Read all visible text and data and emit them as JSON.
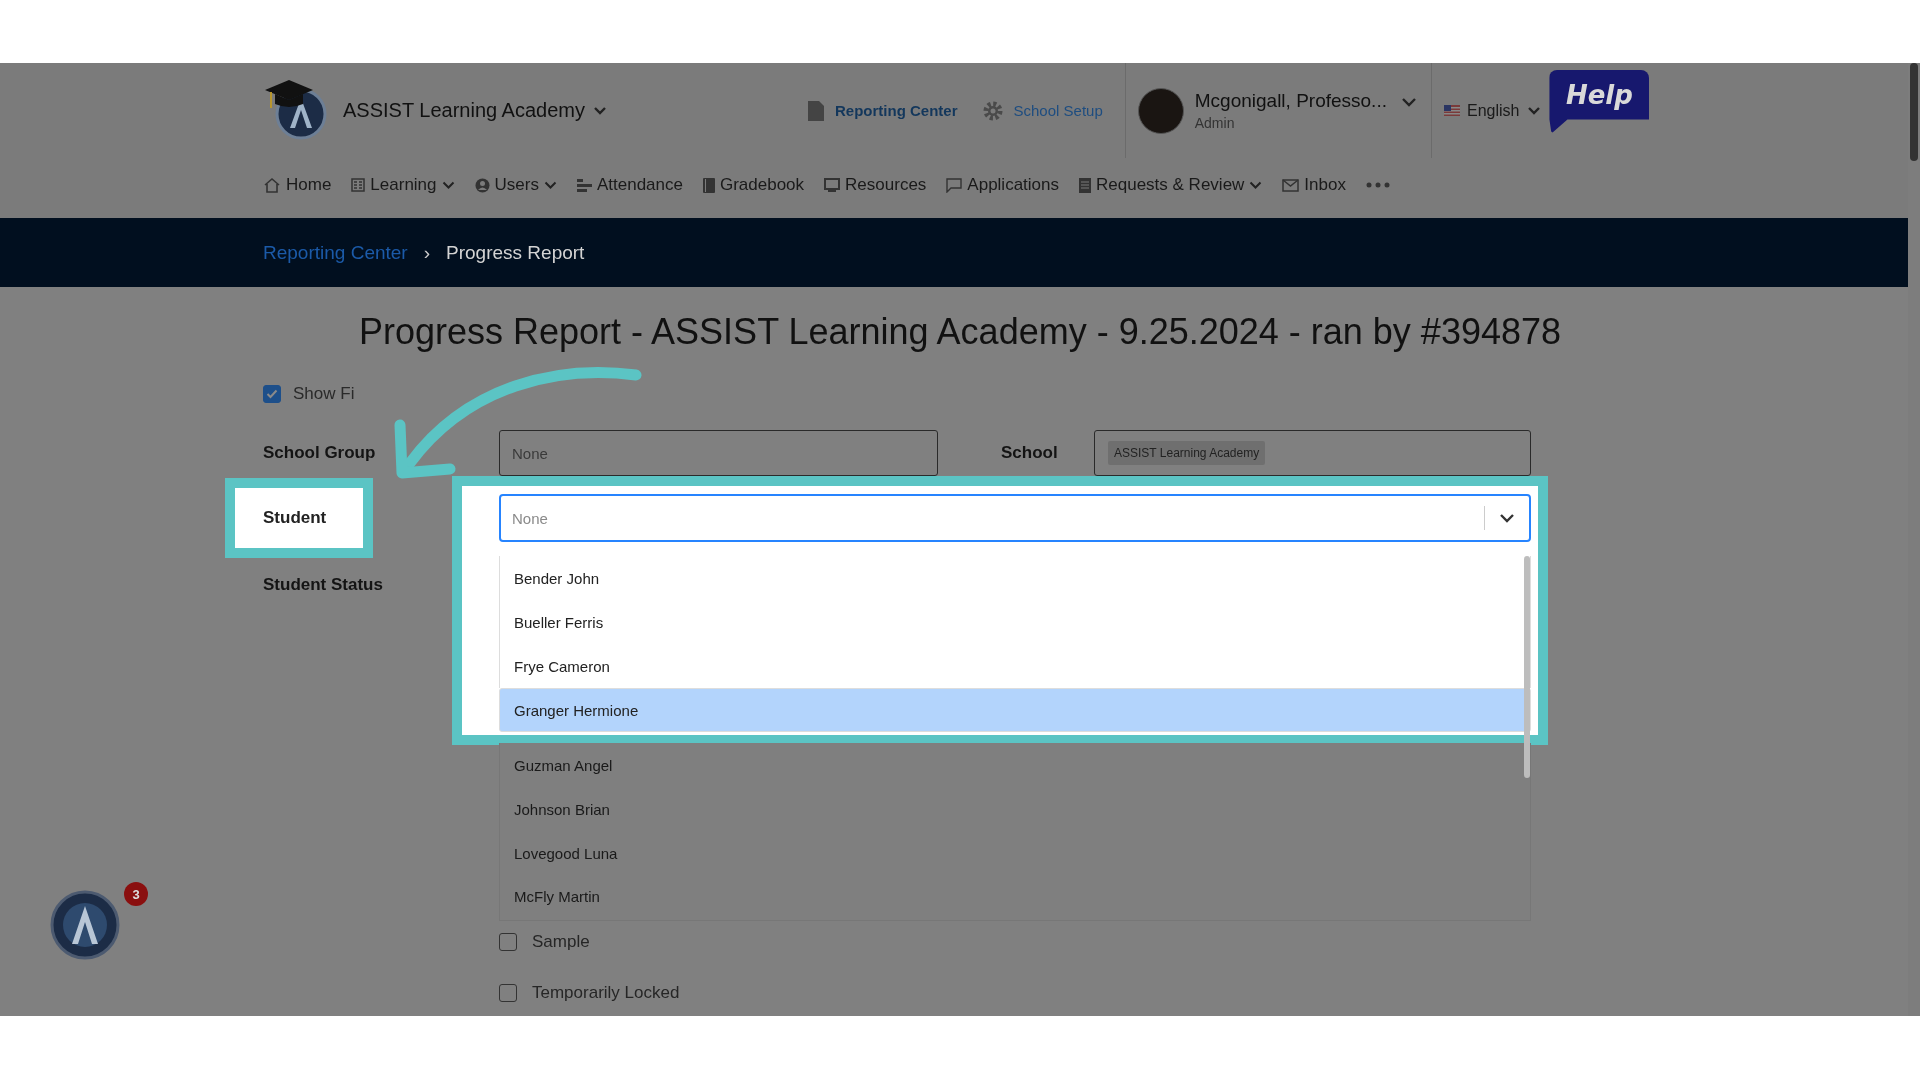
{
  "header": {
    "school_name": "ASSIST Learning Academy",
    "links": [
      {
        "label": "Reporting Center",
        "kind": "document"
      },
      {
        "label": "School Setup",
        "kind": "gear"
      }
    ],
    "user": {
      "name": "Mcgonigall, Professo...",
      "role": "Admin"
    },
    "language": "English",
    "help": "Help"
  },
  "nav": [
    {
      "label": "Home",
      "kind": "home",
      "dropdown": false
    },
    {
      "label": "Learning",
      "kind": "grid",
      "dropdown": true
    },
    {
      "label": "Users",
      "kind": "user",
      "dropdown": true
    },
    {
      "label": "Attendance",
      "kind": "bars",
      "dropdown": false
    },
    {
      "label": "Gradebook",
      "kind": "book",
      "dropdown": false
    },
    {
      "label": "Resources",
      "kind": "monitor",
      "dropdown": false
    },
    {
      "label": "Applications",
      "kind": "chat",
      "dropdown": false
    },
    {
      "label": "Requests & Review",
      "kind": "doc",
      "dropdown": true
    },
    {
      "label": "Inbox",
      "kind": "mail",
      "dropdown": false
    },
    {
      "kind": "more"
    }
  ],
  "breadcrumb": {
    "link": "Reporting Center",
    "separator": "›",
    "current": "Progress Report"
  },
  "title": "Progress Report - ASSIST Learning Academy - 9.25.2024 - ran by #394878",
  "show_filters": {
    "label": "Show Fi",
    "checked": true
  },
  "school_group": {
    "label": "School Group",
    "placeholder": "None"
  },
  "school": {
    "label": "School",
    "tags": [
      "ASSIST Learning Academy"
    ]
  },
  "student": {
    "label": "Student",
    "placeholder": "None",
    "options": [
      {
        "label": "Bender John",
        "selected": false,
        "spotlight": true
      },
      {
        "label": "Bueller Ferris",
        "selected": false,
        "spotlight": true
      },
      {
        "label": "Frye Cameron",
        "selected": false,
        "spotlight": true
      },
      {
        "label": "Granger Hermione",
        "selected": true,
        "spotlight": true
      },
      {
        "label": "Guzman Angel",
        "selected": false,
        "spotlight": false
      },
      {
        "label": "Johnson Brian",
        "selected": false,
        "spotlight": false
      },
      {
        "label": "Lovegood Luna",
        "selected": false,
        "spotlight": false
      },
      {
        "label": "McFly Martin",
        "selected": false,
        "spotlight": false
      }
    ]
  },
  "student_status": {
    "label": "Student Status"
  },
  "checkboxes": [
    {
      "label": "Sample",
      "checked": false
    },
    {
      "label": "Temporarily Locked",
      "checked": false
    }
  ],
  "notification_count": "3"
}
